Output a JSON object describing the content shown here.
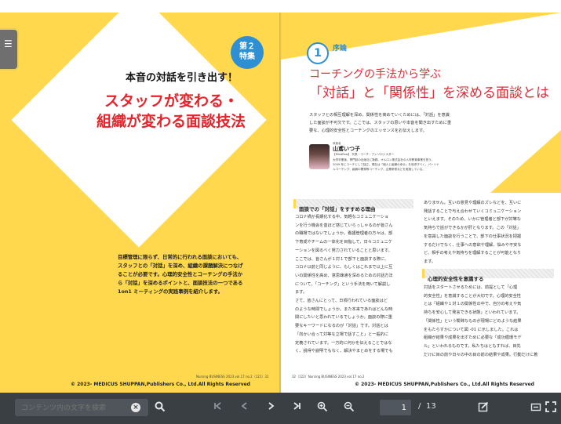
{
  "toolbar": {
    "search_placeholder": "コンテンツ内の文字を検索",
    "current_page": "1",
    "page_separator": "/",
    "total_pages": "13"
  },
  "left_page": {
    "badge_line1": "第２",
    "badge_line2": "特集",
    "subtitle": "本音の対話を引き出す！",
    "title_line1": "スタッフが変わる・",
    "title_line2": "組織が変わる面談技法",
    "lead_lines": [
      "目標管理に限らず、日常的に行われる面談においても、",
      "スタッフとの「対話」を深め、組織の課題解決につなげ",
      "ることが必要です。心理的安全性とコーチングの手法か",
      "ら「対話」を深めるポイントと、面談技法の一つである",
      "1on1 ミーティングの実践事例を紹介します。"
    ],
    "folio": "Nursing BUSINESS 2023 vol.17 no.2（121）31",
    "copyright": "© 2023- MEDICUS SHUPPAN,Publishers Co., Ltd.All Rights Reserved"
  },
  "right_page": {
    "section_number": "1",
    "section_label": "序論",
    "headline_line1": "コーチングの手法から学ぶ",
    "headline_line2": "「対話」と「関係性」を深める面談とは",
    "intro_lines": [
      "スタッフとの相互理解を深め、関係性を高めていくためには、「対話」を意識",
      "した面談が不可欠です。ここでは、スタッフの思いや本音を聞き出すために重",
      "要な、心理的安全性とコーチングのエッセンスをお伝えします。"
    ],
    "author_role": "執筆者",
    "author_name": "山鳶いつ子",
    "author_affiliation": "【Mindflow】 代表・コーチ・アンソロジスター",
    "author_bio_lines": [
      "大学卒業後、専門誌の出版社に勤務。オルロン株式会社の人材教育事業を担う。",
      "2009 年にコーチとして独立。現在は「個人と組織の幸せ」を追求すべく、パーソナ",
      "ルコーチング、組織の開発等コーチング、企業研修などを実施している。"
    ],
    "heading1": "面談での「対話」をすすめる理由",
    "col1_lines": [
      "コロナ禍が長期化する中、気軽なコミュニケーショ",
      "ンを行う機会を昔ほど感じていらっしゃるのが皆さん",
      "の職場ではないでしょうか。看護管理者の方々は、部",
      "下育成やチームの一体化を目指して、日々コミュニケ",
      "ーションを図るべく努力されていることと思います。",
      "ここでは、皆さんが１対１で部下と面談する際に、",
      "コロナ以前と同じように、もしくはこれまで以上に互",
      "いの関係性を高め、意思疎通を深めるための対話方法",
      "について、「コーチング」という手法を用いて解説し",
      "ます。",
      "さて、皆さんにとって、日頃行われている面談はど",
      "のような時間でしょうか。また本来であればどんな時",
      "間にしたいと思われているでしょうか。面談の際に重",
      "要なキーワードになるのが「対話」です。対話とは",
      "「向かい合って対等な立場で話すこと」と一般的に",
      "定義されています。一方的に何かを伝えることではな",
      "く、説得や説明でもなく、解決やまとめをする場でも"
    ],
    "col2_lines": [
      "ありません。互いの意見や理解のズレなどを、互いに",
      "発話することで与え合わせていくコミュニケーション",
      "といえます。そのため、いかに管理者と部下が対等な",
      "気持ちで話ができるかが肝となります。この「対話」",
      "を意識した面談を行うことで、部下の仕事状況を把握",
      "するだけでなく、仕事への意欲や理解、悩みや不安な",
      "ど、相手の考えや気持ちを理解することが可能となり",
      "ます。"
    ],
    "heading2": "心理的安全性を意識する",
    "col2b_lines": [
      "対話をスタートさせるためには、前提として「心理",
      "的安全性」を意識することが大切です。心理的安全性",
      "とは「組織や１対１の関係性の中で、自分の考えや気",
      "持ちを安心して発言できる状態」といわれています。",
      "「関係性」という曖昧なものが現場にどのような結果",
      "をもたらすかについて図 -01 に示しました。これは",
      "組織が結果や成果を出すために必要な「成功循環モデ",
      "ル」といわれるものです。私たちはともすれば、目先",
      "だけに目の前や日々の中の目の前の結果や成果。行動だけに着"
    ],
    "folio": "32（122）Nursing BUSINESS 2023 vol.17 no.2",
    "copyright": "© 2023- MEDICUS SHUPPAN,Publishers Co., Ltd.All Rights Reserved"
  },
  "colors": {
    "yellow": "#ffd84d",
    "red_title": "#e6242c",
    "blue_badge": "#2f8fd3",
    "toolbar_bg": "#3a3f44"
  }
}
